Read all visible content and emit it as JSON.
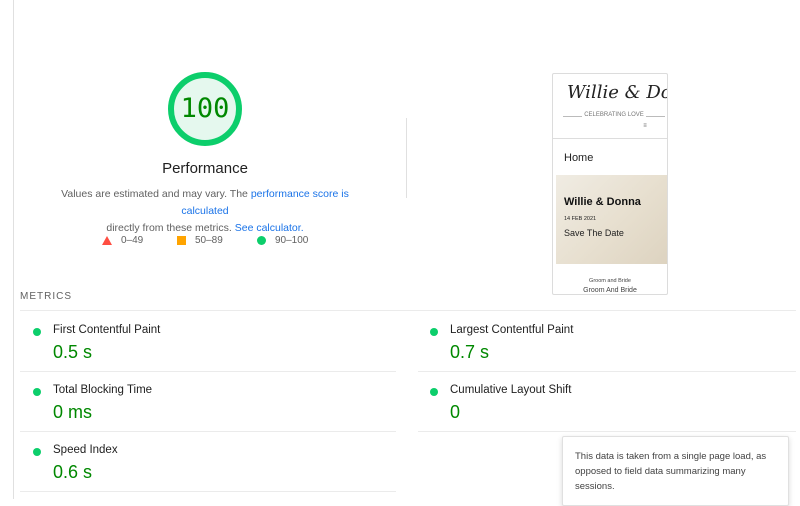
{
  "performance": {
    "score": "100",
    "score_fraction": 1.0,
    "title": "Performance",
    "desc_prefix": "Values are estimated and may vary. The ",
    "desc_link": "performance score is calculated",
    "desc_mid": " directly from these metrics. ",
    "desc_link2": "See calculator.",
    "colors": {
      "pass": "#0cce6b",
      "pass_text": "#008800",
      "average": "#ffa400",
      "fail": "#ff4e42"
    }
  },
  "legend": [
    {
      "label": "0–49",
      "icon": "triangle-icon"
    },
    {
      "label": "50–89",
      "icon": "square-icon"
    },
    {
      "label": "90–100",
      "icon": "circle-icon"
    }
  ],
  "screenshot": {
    "script_title": "Willie & Donna",
    "tagline": "CELEBRATING LOVE",
    "menu_icon": "hamburger-icon",
    "nav_home": "Home",
    "hero_title": "Willie & Donna",
    "hero_date": "14 FEB 2021",
    "hero_save": "Save The Date",
    "groom_bride": "Groom and Bride",
    "cutoff_text": "Groom And Bride"
  },
  "metrics": {
    "label": "METRICS",
    "items": [
      {
        "name": "First Contentful Paint",
        "value": "0.5 s"
      },
      {
        "name": "Largest Contentful Paint",
        "value": "0.7 s"
      },
      {
        "name": "Total Blocking Time",
        "value": "0 ms"
      },
      {
        "name": "Cumulative Layout Shift",
        "value": "0"
      },
      {
        "name": "Speed Index",
        "value": "0.6 s"
      }
    ]
  },
  "tooltip": {
    "text": "This data is taken from a single page load, as opposed to field data summarizing many sessions."
  }
}
